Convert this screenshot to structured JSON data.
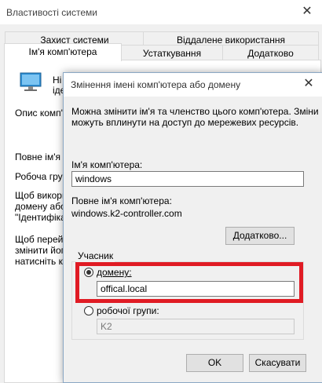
{
  "background_window": {
    "title": "Властивості системи",
    "tabs": [
      {
        "label": "Захист системи"
      },
      {
        "label": "Віддалене використання"
      },
      {
        "label": "Ім'я комп'ютера"
      },
      {
        "label": "Устаткування"
      },
      {
        "label": "Додатково"
      }
    ],
    "partial_texts": {
      "line1": "Ні",
      "line2": "іде",
      "description": "Опис комп'",
      "full_name": "Повне ім'я к",
      "workgroup": "Робоча груп",
      "info1": "Щоб викори",
      "info2": "домену або р",
      "info3": "\"Ідентифікат",
      "info4": "Щоб переймі",
      "info5": "змінити його",
      "info6": "натисніть кн"
    }
  },
  "dialog": {
    "title": "Змінення імені комп'ютера або домену",
    "intro_line1": "Можна змінити ім'я та членство цього комп'ютера. Зміни",
    "intro_line2": "можуть вплинути на доступ до мережевих ресурсів.",
    "computer_name_label": "Ім'я комп'ютера:",
    "computer_name_value": "windows",
    "full_name_label": "Повне ім'я комп'ютера:",
    "full_name_value": "windows.k2-controller.com",
    "more_button": "Додатково...",
    "member_of_label": "Учасник",
    "domain_label": "домену:",
    "domain_value": "offical.local",
    "domain_selected": true,
    "workgroup_label": "робочої групи:",
    "workgroup_value": "K2",
    "ok_button": "OK",
    "cancel_button": "Скасувати"
  },
  "colors": {
    "highlight_box": "#e01b24",
    "dialog_border": "#8aa7c4"
  },
  "icons": {
    "close": "close-icon",
    "computer": "computer-icon"
  }
}
